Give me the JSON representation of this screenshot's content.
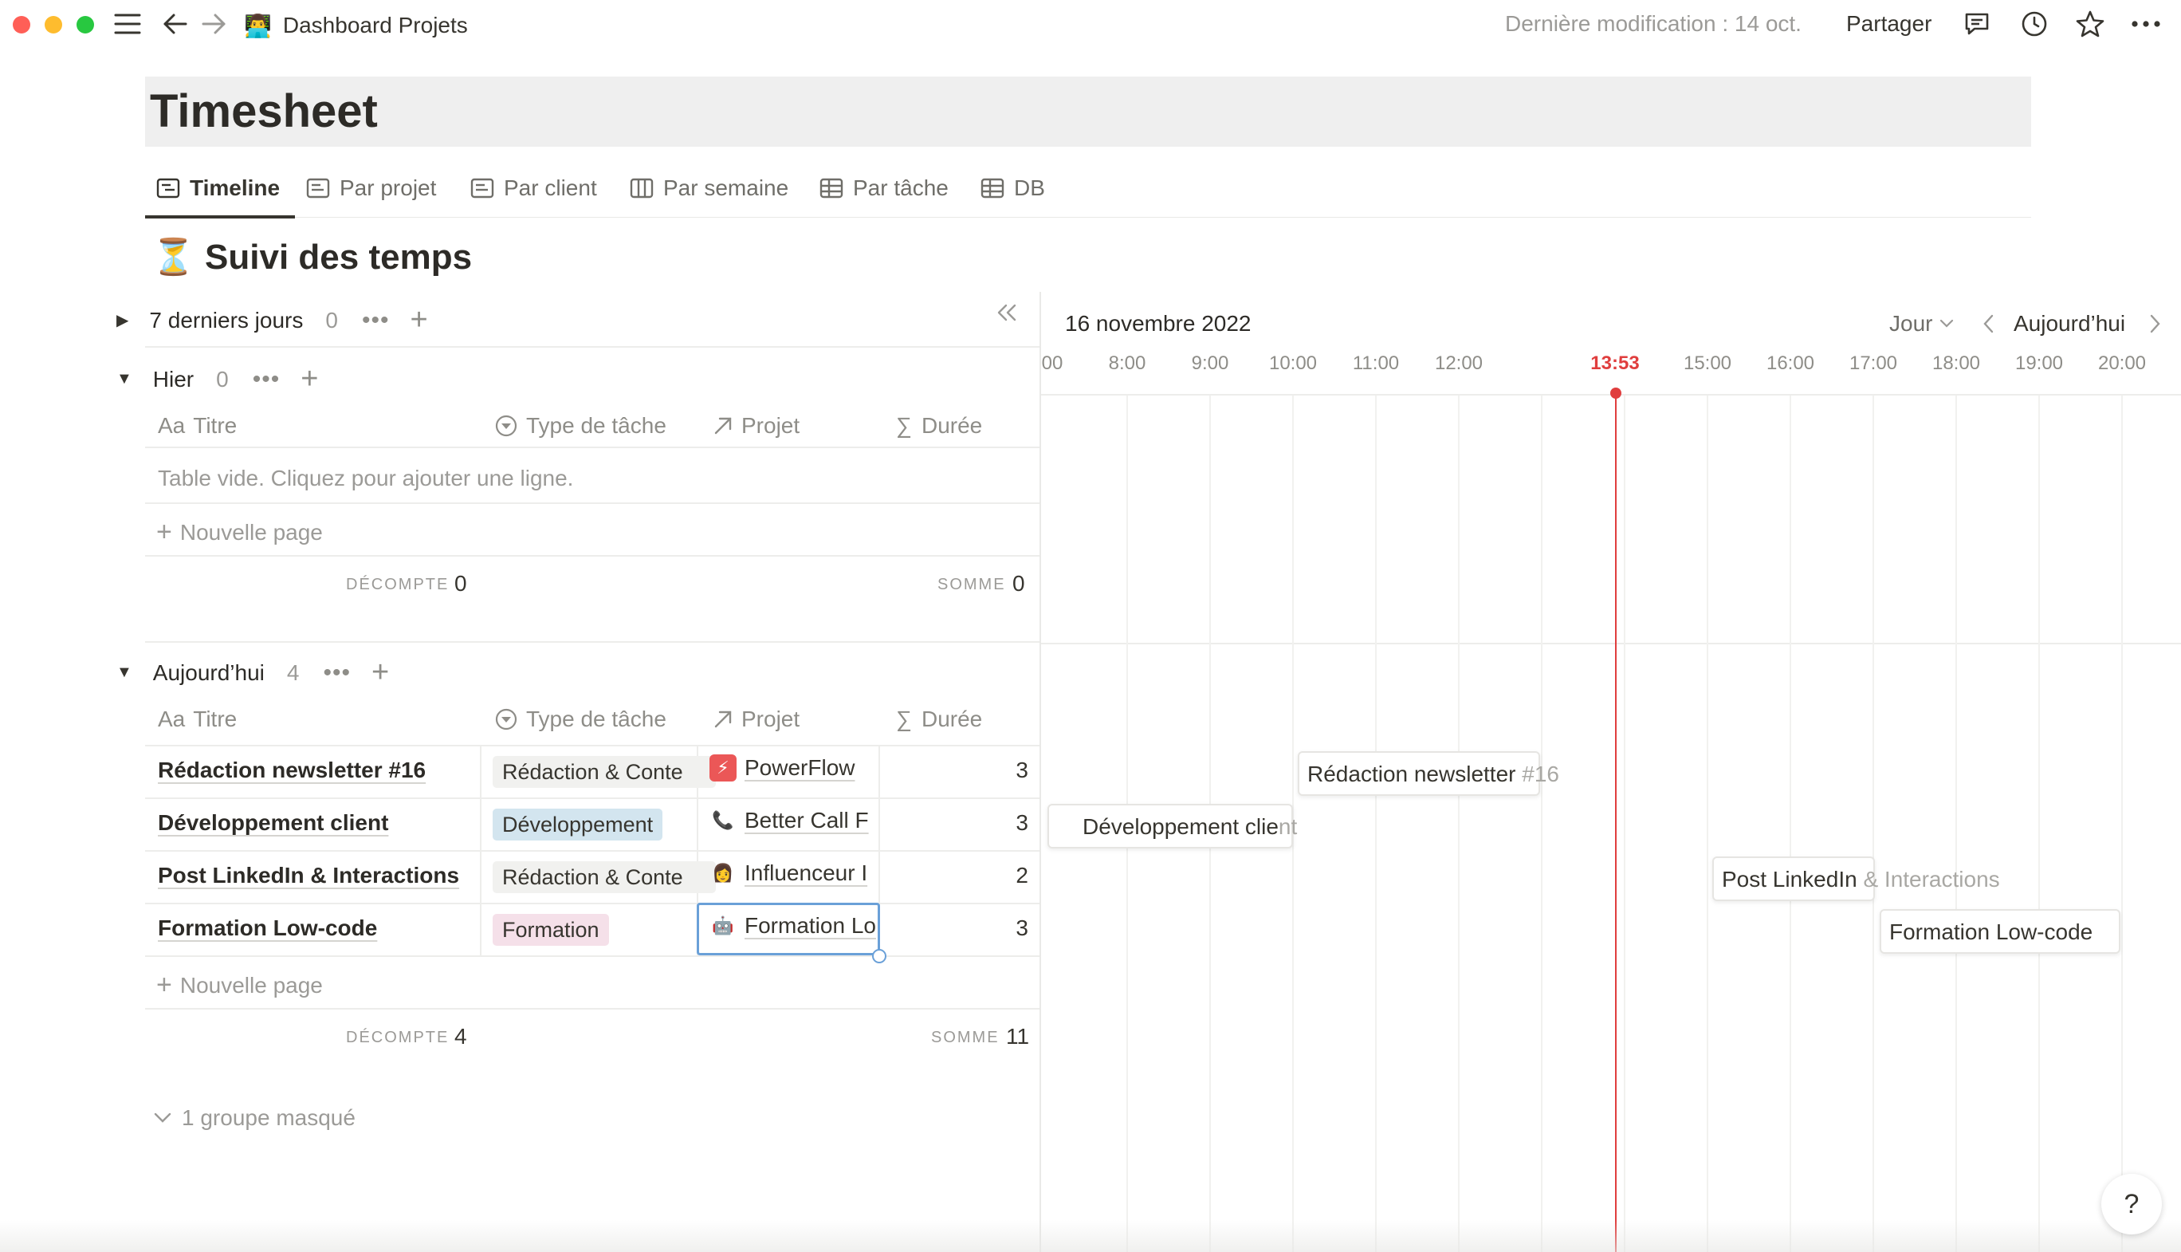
{
  "window": {
    "breadcrumb": "Dashboard Projets",
    "last_modified": "Dernière modification : 14 oct.",
    "share": "Partager"
  },
  "colors": {
    "accent_red": "#e03e3e",
    "tag_dev": "#d3e5ef",
    "tag_formation": "#f5e0e9",
    "tag_redaction": "#f1f1ef"
  },
  "page": {
    "title": "Timesheet"
  },
  "tabs": [
    {
      "label": "Timeline",
      "icon": "timeline-icon"
    },
    {
      "label": "Par projet",
      "icon": "board-icon"
    },
    {
      "label": "Par client",
      "icon": "board-icon"
    },
    {
      "label": "Par semaine",
      "icon": "calendar-icon"
    },
    {
      "label": "Par tâche",
      "icon": "table-icon"
    },
    {
      "label": "DB",
      "icon": "table-icon"
    }
  ],
  "section": {
    "icon": "⏳",
    "title": "Suivi des temps"
  },
  "columns": {
    "titre": "Titre",
    "titre_prefix": "Aa",
    "type": "Type de tâche",
    "projet": "Projet",
    "duree": "Durée"
  },
  "groups": {
    "last7": {
      "label": "7 derniers jours",
      "count": "0"
    },
    "hier": {
      "label": "Hier",
      "count": "0",
      "empty_text": "Table vide. Cliquez pour ajouter une ligne.",
      "new_page": "Nouvelle page",
      "count_label": "DÉCOMPTE",
      "count_value": "0",
      "sum_label": "SOMME",
      "sum_value": "0"
    },
    "today": {
      "label": "Aujourd’hui",
      "count": "4",
      "rows": [
        {
          "title": "Rédaction newsletter #16",
          "type": "Rédaction & Conte",
          "project": "PowerFlow",
          "project_icon": "⚡",
          "duration": "3"
        },
        {
          "title": "Développement client",
          "type": "Développement",
          "project": "Better Call F",
          "project_icon": "📞",
          "duration": "3"
        },
        {
          "title": "Post LinkedIn & Interactions",
          "type": "Rédaction & Conte",
          "project": "Influenceur I",
          "project_icon": "👩",
          "duration": "2"
        },
        {
          "title": "Formation Low-code",
          "type": "Formation",
          "project": "Formation Lo",
          "project_icon": "🤖",
          "duration": "3"
        }
      ],
      "new_page": "Nouvelle page",
      "count_label": "DÉCOMPTE",
      "count_value": "4",
      "sum_label": "SOMME",
      "sum_value": "11"
    },
    "hidden": "1 groupe masqué"
  },
  "timeline": {
    "date": "16 novembre 2022",
    "zoom": "Jour",
    "today": "Aujourd’hui",
    "hours": [
      "00",
      "8:00",
      "9:00",
      "10:00",
      "11:00",
      "12:00",
      "15:00",
      "16:00",
      "17:00",
      "18:00",
      "19:00",
      "20:00"
    ],
    "now": "13:53",
    "cards": [
      {
        "main": "Rédaction newsletter ",
        "rest": "#16"
      },
      {
        "main": "Développement clie",
        "rest": "nt"
      },
      {
        "main": "Post LinkedIn ",
        "rest": "& Interactions"
      },
      {
        "main": "Formation Low-code",
        "rest": ""
      }
    ]
  },
  "help": "?"
}
